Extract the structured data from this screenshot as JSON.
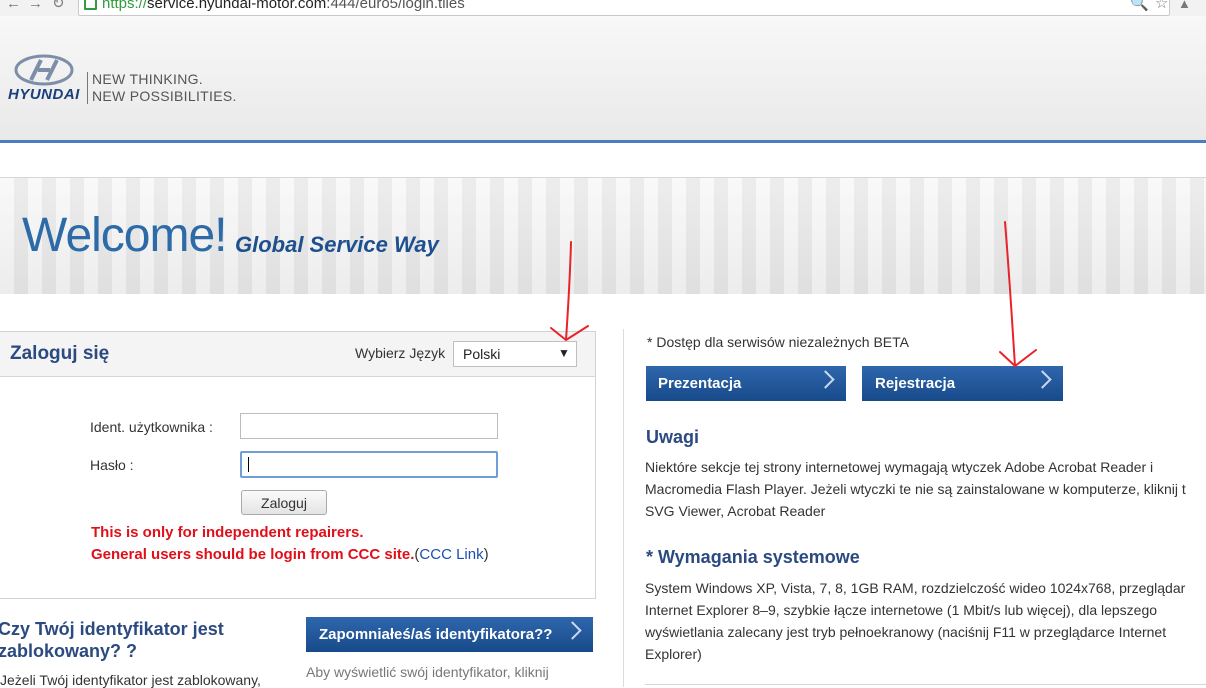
{
  "browser": {
    "url_scheme": "https://",
    "url_host": "service.hyundai-motor.com",
    "url_rest": ":444/euro5/login.tiles",
    "icons": [
      "back-arrow-icon",
      "reload-icon",
      "lock-icon",
      "zoom-icon",
      "star-icon"
    ]
  },
  "header": {
    "logo_text": "HYUNDAI",
    "tagline_line1": "NEW THINKING.",
    "tagline_line2": "NEW POSSIBILITIES."
  },
  "banner": {
    "welcome": "Welcome!",
    "subtitle": "Global Service Way"
  },
  "login": {
    "title": "Zaloguj się",
    "language_label": "Wybierz Język",
    "language_value": "Polski",
    "user_label": "Ident. użytkownika  :",
    "user_value": "",
    "password_label": "Hasło  :",
    "password_value": "",
    "login_button": "Zaloguj",
    "warning_line1": "This is only for independent repairers.",
    "warning_line2": "General users should be login from CCC site.",
    "paren_open": "(",
    "ccc_link": "CCC Link",
    "paren_close": ")"
  },
  "blocked": {
    "title": "Czy Twój identyfikator jest zablokowany? ?",
    "text": "Jeżeli Twój identyfikator jest zablokowany,",
    "forgot_button": "Zapomniałeś/aś identyfikatora??",
    "forgot_hint": "Aby wyświetlić swój identyfikator, kliknij"
  },
  "right": {
    "beta_note": "* Dostęp dla serwisów niezależnych BETA",
    "btn_presentation": "Prezentacja",
    "btn_registration": "Rejestracja",
    "notes_title": "Uwagi",
    "notes_text": "Niektóre sekcje tej strony internetowej wymagają wtyczek Adobe Acrobat Reader i Macromedia Flash Player. Jeżeli wtyczki te nie są zainstalowane w komputerze, kliknij t SVG Viewer, Acrobat Reader",
    "req_title": "* Wymagania systemowe",
    "req_text": "System Windows XP, Vista, 7, 8, 1GB RAM, rozdzielczość wideo 1024x768, przeglądar Internet Explorer 8–9, szybkie łącze internetowe (1 Mbit/s lub więcej), dla lepszego wyświetlania zalecany jest tryb pełnoekranowy (naciśnij F11 w przeglądarce Internet Explorer)"
  },
  "colors": {
    "brand_blue": "#2b4a80",
    "button_blue": "#174a8a",
    "warning_red": "#e0101a",
    "link_blue": "#1a4fb0",
    "annotation_red": "#e8232a"
  }
}
